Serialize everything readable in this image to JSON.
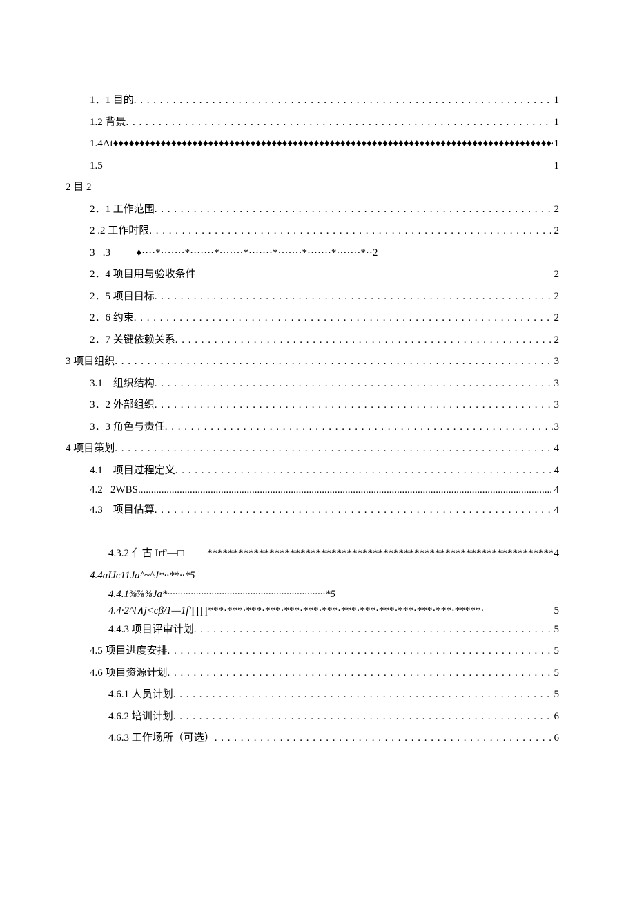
{
  "leaders": {
    "dots": "  . . . . . . . . . . . . . . . . . . . . . . . . . . . . . . . . . . . . . . . . . . . . . . . . . . . . . . . . . . . . . . . . . . . . . . . . . . . . . . . . . . . . . . . . . . . . . . . . . . . . . . . . . . . . . . . . . . . . . . . . . . . . . . . . . . . . . . . . . . . . . . . . . . . . . . . . . . . . . . . . . . . . . . . . . . . . . .",
    "tightdots": "............................................................................................................................................................................................................................................................",
    "diamonds": "♦♦♦♦♦♦♦♦♦♦♦♦♦♦♦♦♦♦♦♦♦♦♦♦♦♦♦♦♦♦♦♦♦♦♦♦♦♦♦♦♦♦♦♦♦♦♦♦♦♦♦♦♦♦♦♦♦♦♦♦♦♦♦♦♦♦♦♦♦♦♦♦♦♦♦♦♦♦♦♦♦♦♦♦♦♦♦♦♦♦♦♦♦♦♦♦♦♦♦♦♦♦♦♦♦♦♦♦♦♦♦♦♦♦♦♦♦♦♦♦",
    "stars_432": "**********************************************************************************************************************************************",
    "stardots_442": "***·***·***·***·***·***·***·***·***·***·***·***·***·*****·"
  },
  "entries": {
    "e1_1": {
      "label": "1．1 目的",
      "page": "1"
    },
    "e1_2": {
      "label": "1.2 背景",
      "page": "1"
    },
    "e1_4": {
      "label": "1.4At",
      "page": "1"
    },
    "e1_5": {
      "label": "1.5",
      "page": "1"
    },
    "e2": {
      "label": "2 目 2"
    },
    "e2_1": {
      "label": "2．1 工作范围",
      "page": "2"
    },
    "e2_2": {
      "label": "2   .2 工作时限",
      "page": "2"
    },
    "e2_3": {
      "label": "3   .3          ♦····*·······*·······*·······*·······*·······*·······*·······*··2"
    },
    "e2_4": {
      "label": "2．4 项目用与验收条件",
      "page": "2"
    },
    "e2_5": {
      "label": "2．5 项目目标",
      "page": "2"
    },
    "e2_6": {
      "label": "2．6 约束",
      "page": "2"
    },
    "e2_7": {
      "label": "2．7 关键依赖关系",
      "page": "2"
    },
    "e3": {
      "label": "3 项目组织",
      "page": "3"
    },
    "e3_1": {
      "label": "3.1    组织结构",
      "page": "3"
    },
    "e3_2": {
      "label": "3．2 外部组织",
      "page": "3"
    },
    "e3_3": {
      "label": "3．3 角色与责任",
      "page": "3"
    },
    "e4": {
      "label": "4 项目策划",
      "page": "4"
    },
    "e4_1": {
      "label": "4.1    项目过程定义",
      "page": "4"
    },
    "e4_2": {
      "label": "4.2   2WBS",
      "page": "4"
    },
    "e4_3": {
      "label": "4.3    项目估算",
      "page": "4"
    },
    "e4_3_2": {
      "label": "4.3.2 亻古 Irf'—□         ",
      "page": "4"
    },
    "e4_4": {
      "label": "4.4aIJc11Ja^~^J*··**··*5"
    },
    "e4_4_1": {
      "label": "4.4.1⅜⅞⅜Ja*·····························································*5"
    },
    "e4_4_2": {
      "label": "4.4·2^l∧j<cβ/1—1f'∏∏",
      "page": "5"
    },
    "e4_4_3": {
      "label": "4.4.3 项目评审计划",
      "page": "5"
    },
    "e4_5": {
      "label": "4.5 项目进度安排",
      "page": "5"
    },
    "e4_6": {
      "label": "4.6 项目资源计划",
      "page": "5"
    },
    "e4_6_1": {
      "label": "4.6.1 人员计划",
      "page": "5"
    },
    "e4_6_2": {
      "label": "4.6.2 培训计划",
      "page": "6"
    },
    "e4_6_3": {
      "label": "4.6.3 工作场所（可选）",
      "page": "6"
    }
  }
}
